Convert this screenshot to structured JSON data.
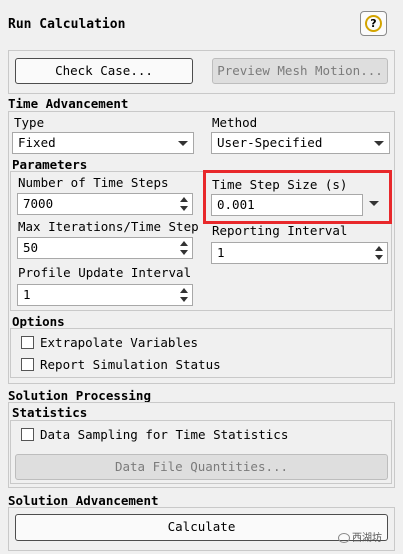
{
  "title": "Run Calculation",
  "help": {
    "label": "?"
  },
  "top_buttons": {
    "check_case": "Check Case...",
    "preview_mesh_motion": "Preview Mesh Motion..."
  },
  "time_advancement": {
    "header": "Time Advancement",
    "type": {
      "label": "Type",
      "value": "Fixed"
    },
    "method": {
      "label": "Method",
      "value": "User-Specified"
    },
    "parameters": {
      "header": "Parameters",
      "num_time_steps": {
        "label": "Number of Time Steps",
        "value": "7000"
      },
      "time_step_size": {
        "label": "Time Step Size (s)",
        "value": "0.001"
      },
      "max_iterations": {
        "label": "Max Iterations/Time Step",
        "value": "50"
      },
      "reporting_interval": {
        "label": "Reporting Interval",
        "value": "1"
      },
      "profile_update_interval": {
        "label": "Profile Update Interval",
        "value": "1"
      }
    },
    "options": {
      "header": "Options",
      "extrapolate_variables": {
        "label": "Extrapolate Variables",
        "checked": false
      },
      "report_simulation_status": {
        "label": "Report Simulation Status",
        "checked": false
      }
    }
  },
  "solution_processing": {
    "header": "Solution Processing",
    "statistics": {
      "header": "Statistics",
      "data_sampling": {
        "label": "Data Sampling for Time Statistics",
        "checked": false
      },
      "data_file_quantities_button": "Data File Quantities..."
    }
  },
  "solution_advancement": {
    "header": "Solution Advancement",
    "calculate_button": "Calculate"
  },
  "watermark": {
    "text": "西湖坊"
  },
  "colors": {
    "highlight": "#e8282b",
    "help_ring": "#d3a400",
    "background": "#f0f0f0"
  }
}
